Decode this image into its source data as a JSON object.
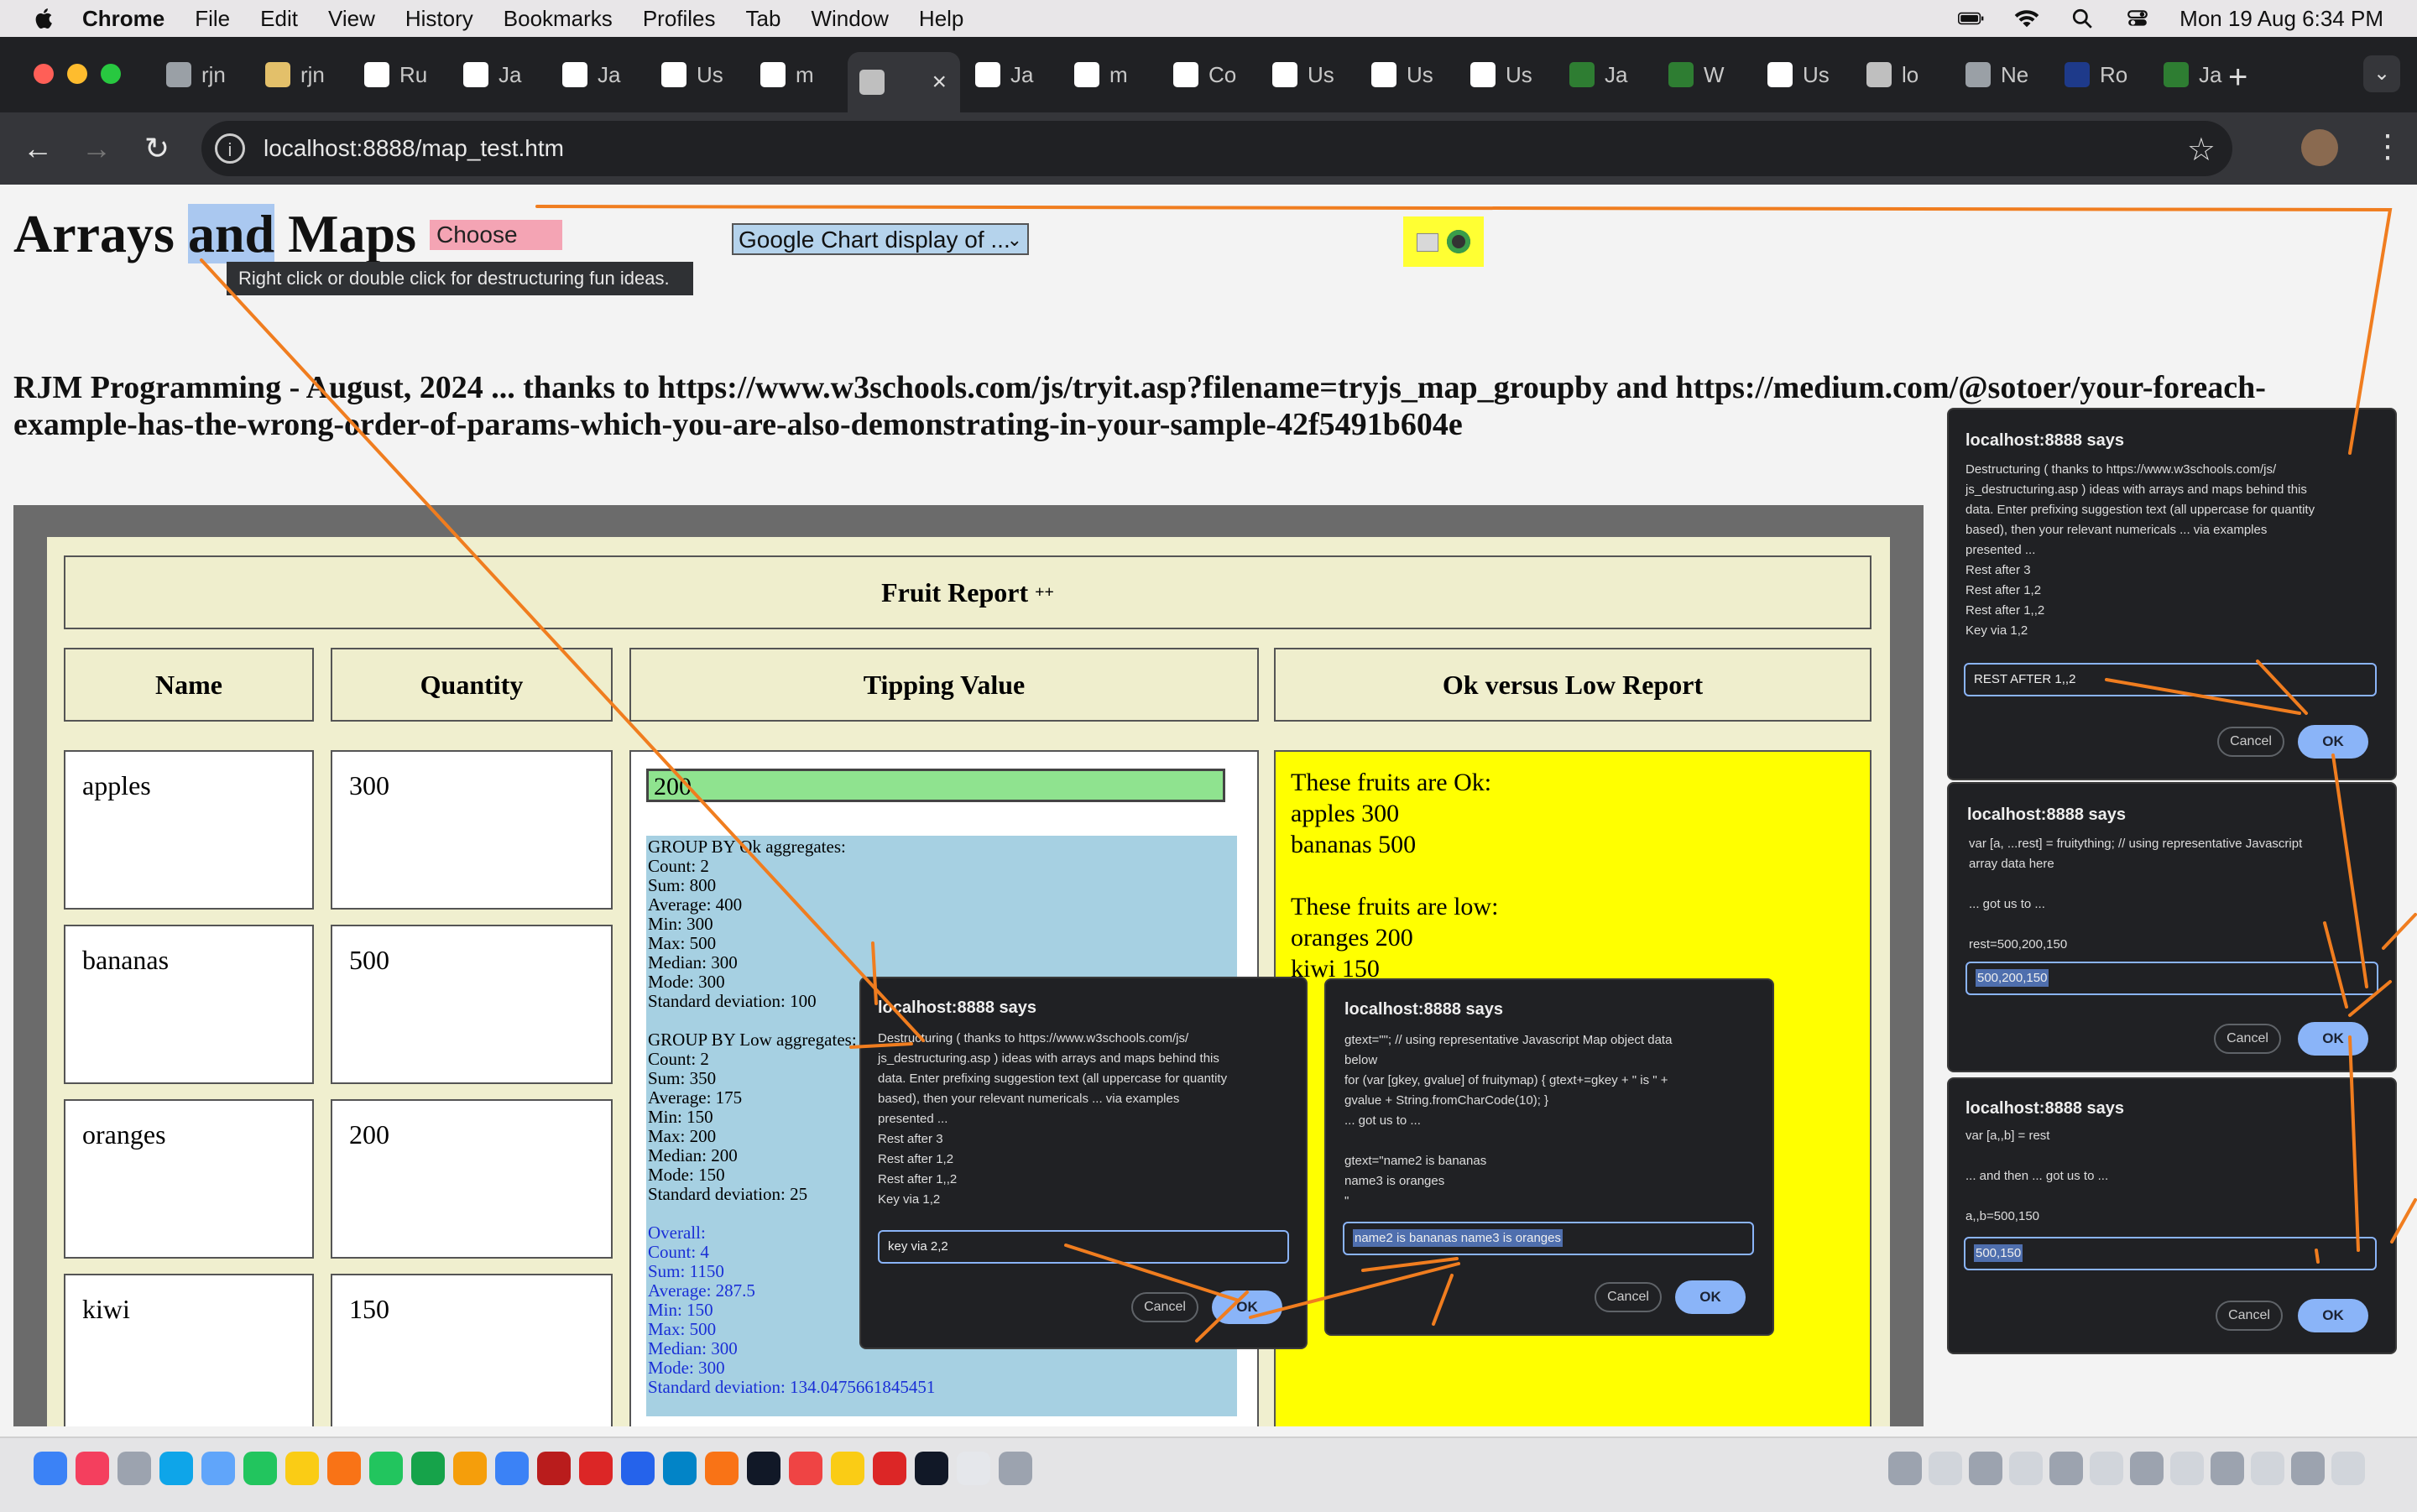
{
  "menubar": {
    "app_name": "Chrome",
    "items": [
      "File",
      "Edit",
      "View",
      "History",
      "Bookmarks",
      "Profiles",
      "Tab",
      "Window",
      "Help"
    ],
    "datetime": "Mon 19 Aug  6:34 PM"
  },
  "tabs": [
    {
      "label": "rjn",
      "color": "#9aa0a6"
    },
    {
      "label": "rjn",
      "color": "#e3c06a"
    },
    {
      "label": "Ru",
      "color": "#ffffff"
    },
    {
      "label": "Ja",
      "color": "#ffffff"
    },
    {
      "label": "Ja",
      "color": "#ffffff"
    },
    {
      "label": "Us",
      "color": "#ffffff"
    },
    {
      "label": "m",
      "color": "#ffffff"
    },
    {
      "label": "",
      "color": "#bfbfbf",
      "active": true
    },
    {
      "label": "Ja",
      "color": "#ffffff"
    },
    {
      "label": "m",
      "color": "#ffffff"
    },
    {
      "label": "Co",
      "color": "#ffffff"
    },
    {
      "label": "Us",
      "color": "#ffffff"
    },
    {
      "label": "Us",
      "color": "#ffffff"
    },
    {
      "label": "Us",
      "color": "#ffffff"
    },
    {
      "label": "Ja",
      "color": "#2e7d32"
    },
    {
      "label": "W",
      "color": "#2e7d32"
    },
    {
      "label": "Us",
      "color": "#ffffff"
    },
    {
      "label": "lo",
      "color": "#bfbfbf"
    },
    {
      "label": "Ne",
      "color": "#9aa0a6"
    },
    {
      "label": "Ro",
      "color": "#1e3a8a"
    },
    {
      "label": "Ja",
      "color": "#2e7d32"
    }
  ],
  "address_bar": {
    "url": "localhost:8888/map_test.htm"
  },
  "page": {
    "title_pre": "Arrays ",
    "title_highlight": "and",
    "title_post": " Maps",
    "choose_files": "Choose files",
    "tooltip": "Right click or double click for destructuring fun ideas.",
    "chart_select": "Google Chart display of ...",
    "subtitle": "RJM Programming - August, 2024 ... thanks to https://www.w3schools.com/js/tryit.asp?filename=tryjs_map_groupby and https://medium.com/@sotoer/your-foreach-example-has-the-wrong-order-of-params-which-you-are-also-demonstrating-in-your-sample-42f5491b604e"
  },
  "report": {
    "title": "Fruit Report",
    "title_sup": "++",
    "headers": [
      "Name",
      "Quantity",
      "Tipping Value",
      "Ok versus Low Report"
    ],
    "rows": [
      {
        "name": "apples",
        "quantity": "300"
      },
      {
        "name": "bananas",
        "quantity": "500"
      },
      {
        "name": "oranges",
        "quantity": "200"
      },
      {
        "name": "kiwi",
        "quantity": "150"
      }
    ],
    "tipping_value": "200",
    "ok_group": [
      "GROUP BY Ok aggregates:",
      "Count: 2",
      "Sum: 800",
      "Average: 400",
      "Min: 300",
      "Max: 500",
      "Median: 300",
      "Mode: 300",
      "Standard deviation: 100"
    ],
    "low_group": [
      "GROUP BY Low aggregates:",
      "Count: 2",
      "Sum: 350",
      "Average: 175",
      "Min: 150",
      "Max: 200",
      "Median: 200",
      "Mode: 150",
      "Standard deviation: 25"
    ],
    "overall": [
      "Overall:",
      "Count: 4",
      "Sum: 1150",
      "Average: 287.5",
      "Min: 150",
      "Max: 500",
      "Median: 300",
      "Mode: 300",
      "Standard deviation: 134.0475661845451"
    ],
    "ok_heading": "These fruits are Ok:",
    "ok_items": [
      "apples 300",
      "bananas 500"
    ],
    "low_heading": "These fruits are low:",
    "low_items": [
      "oranges 200",
      "kiwi 150"
    ]
  },
  "dialogs": [
    {
      "title": "localhost:8888 says",
      "message": "Destructuring ( thanks to https://www.w3schools.com/js/\njs_destructuring.asp ) ideas with arrays and maps behind this\ndata.  Enter prefixing suggestion text (all uppercase for quantity\nbased), then your relevant numericals ... via examples\npresented ...\nRest after 3\nRest after 1,2\nRest after 1,,2\nKey via 1,2",
      "input": "key via 2,2",
      "cancel": "Cancel",
      "ok": "OK"
    },
    {
      "title": "localhost:8888 says",
      "message": "gtext=\"\"; // using representative Javascript Map object data\nbelow\nfor (var [gkey, gvalue] of fruitymap) { gtext+=gkey + \" is \" +\ngvalue + String.fromCharCode(10); }\n ... got us to ...\n\ngtext=\"name2 is bananas\nname3 is oranges\n\"",
      "input": "name2 is bananas name3 is oranges",
      "cancel": "Cancel",
      "ok": "OK"
    },
    {
      "title": "localhost:8888 says",
      "message": "Destructuring ( thanks to https://www.w3schools.com/js/\njs_destructuring.asp ) ideas with arrays and maps behind this\ndata.  Enter prefixing suggestion text (all uppercase for quantity\nbased), then your relevant numericals ... via examples\npresented ...\nRest after 3\nRest after 1,2\nRest after 1,,2\nKey via 1,2",
      "input": "REST AFTER 1,,2",
      "cancel": "Cancel",
      "ok": "OK"
    },
    {
      "title": "localhost:8888 says",
      "message": "var [a, ...rest] = fruitything;  // using representative Javascript\narray data here\n\n ... got us to ...\n\nrest=500,200,150",
      "input": "500,200,150",
      "cancel": "Cancel",
      "ok": "OK"
    },
    {
      "title": "localhost:8888 says",
      "message": "var [a,,b] = rest\n\n ... and then ... got us to ...\n\na,,b=500,150",
      "input": "500,150",
      "cancel": "Cancel",
      "ok": "OK"
    }
  ],
  "colors": {
    "annotation_arrow": "#f07d1f",
    "dialog_bg": "#202124",
    "ok_report_bg": "#ffff00",
    "aggregate_bg": "#a6d0e2",
    "tipping_input_bg": "#8fe38f"
  },
  "dock_icons": [
    "finder-icon",
    "music-icon",
    "launchpad-icon",
    "safari-icon",
    "mail-icon",
    "messages-icon",
    "notes-icon",
    "photos-icon",
    "facetime-icon",
    "numbers-icon",
    "pages-icon",
    "appstore-icon",
    "filezilla-icon",
    "acrobat-icon",
    "zoom-icon",
    "xcode-icon",
    "firefox-icon",
    "appletv-icon",
    "calendar-icon",
    "chrome-icon",
    "opera-icon",
    "terminal-icon",
    "textedit-icon",
    "trash-icon"
  ]
}
